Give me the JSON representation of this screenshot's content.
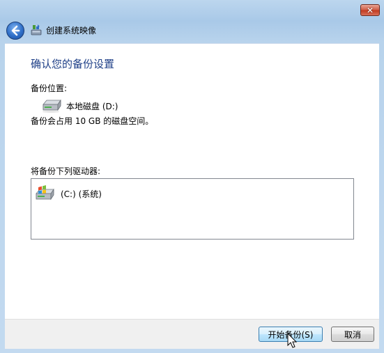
{
  "window": {
    "title": "创建系统映像",
    "close_label": "✕"
  },
  "main": {
    "heading": "确认您的备份设置",
    "backup_location_label": "备份位置:",
    "backup_drive_name": "本地磁盘 (D:)",
    "backup_usage": "备份会占用 10 GB 的磁盘空间。",
    "drives_label": "将备份下列驱动器:",
    "drives": [
      {
        "label": "(C:) (系统)"
      }
    ]
  },
  "footer": {
    "start_button": "开始备份(S)",
    "cancel_button": "取消"
  }
}
